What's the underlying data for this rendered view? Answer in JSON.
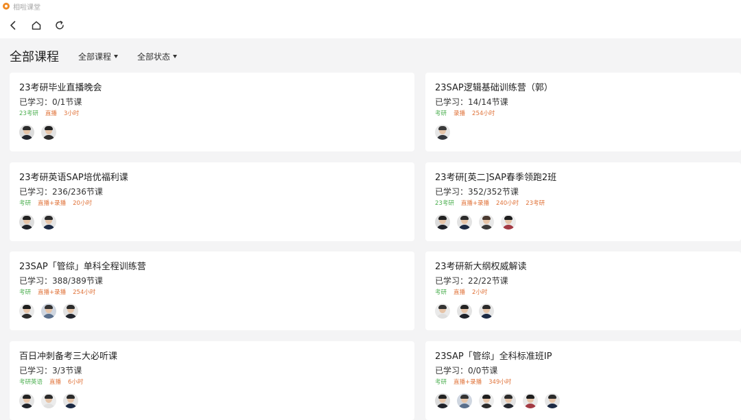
{
  "app": {
    "title": "相啦课堂"
  },
  "page": {
    "title": "全部课程"
  },
  "filters": [
    "全部课程",
    "全部状态"
  ],
  "colors": {
    "tag_green": "#4caf50",
    "tag_orange": "#e0733a",
    "card_bg": "#ffffff",
    "page_bg": "#f4f4f5"
  },
  "nav_icons": [
    "back-icon",
    "home-icon",
    "refresh-icon"
  ],
  "courses": [
    {
      "title": "23考研毕业直播晚会",
      "progress": "已学习：0/1节课",
      "tags": [
        {
          "text": "23考研",
          "color": "green"
        },
        {
          "text": "直播",
          "color": "orange"
        },
        {
          "text": "3小时",
          "color": "orange"
        }
      ],
      "avatars": [
        {
          "bg": "#dcdcdc",
          "hair": "#2b2b2b",
          "body": "#23262e"
        },
        {
          "bg": "#e3e3e3",
          "hair": "#222222",
          "body": "#2e2e2e"
        }
      ]
    },
    {
      "title": "23SAP逻辑基础训练营（郭）",
      "progress": "已学习：14/14节课",
      "tags": [
        {
          "text": "考研",
          "color": "green"
        },
        {
          "text": "录播",
          "color": "orange"
        },
        {
          "text": "254小时",
          "color": "orange"
        }
      ],
      "avatars": [
        {
          "bg": "#e6e6e6",
          "hair": "#3a3a3a",
          "body": "#34373d"
        }
      ]
    },
    {
      "title": "23考研英语SAP培优福利课",
      "progress": "已学习：236/236节课",
      "tags": [
        {
          "text": "考研",
          "color": "green"
        },
        {
          "text": "直播+录播",
          "color": "orange"
        },
        {
          "text": "20小时",
          "color": "orange"
        }
      ],
      "avatars": [
        {
          "bg": "#dddddd",
          "hair": "#222222",
          "body": "#1f2229"
        },
        {
          "bg": "#e6e6e6",
          "hair": "#2b2b2b",
          "body": "#1c2a44"
        }
      ]
    },
    {
      "title": "23考研[英二]SAP春季领跑2班",
      "progress": "已学习：352/352节课",
      "tags": [
        {
          "text": "23考研",
          "color": "green"
        },
        {
          "text": "直播+录播",
          "color": "orange"
        },
        {
          "text": "240小时",
          "color": "orange"
        },
        {
          "text": "23考研",
          "color": "orange"
        }
      ],
      "avatars": [
        {
          "bg": "#dcdcdc",
          "hair": "#222222",
          "body": "#1f2229"
        },
        {
          "bg": "#e3e3e3",
          "hair": "#2b2b2b",
          "body": "#1c2a44"
        },
        {
          "bg": "#e8e8e8",
          "hair": "#4a3a30",
          "body": "#3a3a3a"
        },
        {
          "bg": "#ececec",
          "hair": "#1e1e1e",
          "body": "#a33a44"
        }
      ]
    },
    {
      "title": "23SAP「管综」单科全程训练营",
      "progress": "已学习：388/389节课",
      "tags": [
        {
          "text": "考研",
          "color": "green"
        },
        {
          "text": "直播+录播",
          "color": "orange"
        },
        {
          "text": "254小时",
          "color": "orange"
        }
      ],
      "avatars": [
        {
          "bg": "#e8e8e8",
          "hair": "#1e1e1e",
          "body": "#2b2b2b"
        },
        {
          "bg": "#cfd6e0",
          "hair": "#333333",
          "body": "#5a6f8c"
        },
        {
          "bg": "#e3e3e3",
          "hair": "#2b2b2b",
          "body": "#23262e"
        }
      ]
    },
    {
      "title": "23考研新大纲权威解读",
      "progress": "已学习：22/22节课",
      "tags": [
        {
          "text": "考研",
          "color": "green"
        },
        {
          "text": "直播",
          "color": "orange"
        },
        {
          "text": "2小时",
          "color": "orange"
        }
      ],
      "avatars": [
        {
          "bg": "#eaeaea",
          "hair": "#333333",
          "body": "#dedede"
        },
        {
          "bg": "#e3e3e3",
          "hair": "#222222",
          "body": "#1f2229"
        },
        {
          "bg": "#e6e6e6",
          "hair": "#2b2b2b",
          "body": "#1c2a44"
        }
      ]
    },
    {
      "title": "百日冲刺备考三大必听课",
      "progress": "已学习：3/3节课",
      "tags": [
        {
          "text": "考研英语",
          "color": "green"
        },
        {
          "text": "直播",
          "color": "orange"
        },
        {
          "text": "6小时",
          "color": "orange"
        }
      ],
      "avatars": [
        {
          "bg": "#e3e3e3",
          "hair": "#222222",
          "body": "#1f2229"
        },
        {
          "bg": "#ececec",
          "hair": "#2b2b2b",
          "body": "#e0e0e0"
        },
        {
          "bg": "#e6e6e6",
          "hair": "#2b2b2b",
          "body": "#1c2a44"
        }
      ]
    },
    {
      "title": "23SAP「管综」全科标准班IP",
      "progress": "已学习：0/0节课",
      "tags": [
        {
          "text": "考研",
          "color": "green"
        },
        {
          "text": "直播+录播",
          "color": "orange"
        },
        {
          "text": "349小时",
          "color": "orange"
        }
      ],
      "avatars": [
        {
          "bg": "#dcdcdc",
          "hair": "#222222",
          "body": "#1f2229"
        },
        {
          "bg": "#cfd6e0",
          "hair": "#333333",
          "body": "#5a6f8c"
        },
        {
          "bg": "#ececec",
          "hair": "#1e1e1e",
          "body": "#2b2b2b"
        },
        {
          "bg": "#e3e3e3",
          "hair": "#2b2b2b",
          "body": "#23262e"
        },
        {
          "bg": "#eaeaea",
          "hair": "#1e1e1e",
          "body": "#a33a44"
        },
        {
          "bg": "#e6e6e6",
          "hair": "#2b2b2b",
          "body": "#1c2a44"
        }
      ]
    }
  ]
}
